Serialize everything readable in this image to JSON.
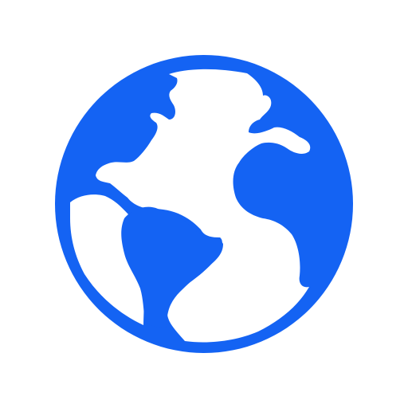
{
  "icon": {
    "name": "globe-icon",
    "color": "#1463f3",
    "background": "#ffffff"
  }
}
